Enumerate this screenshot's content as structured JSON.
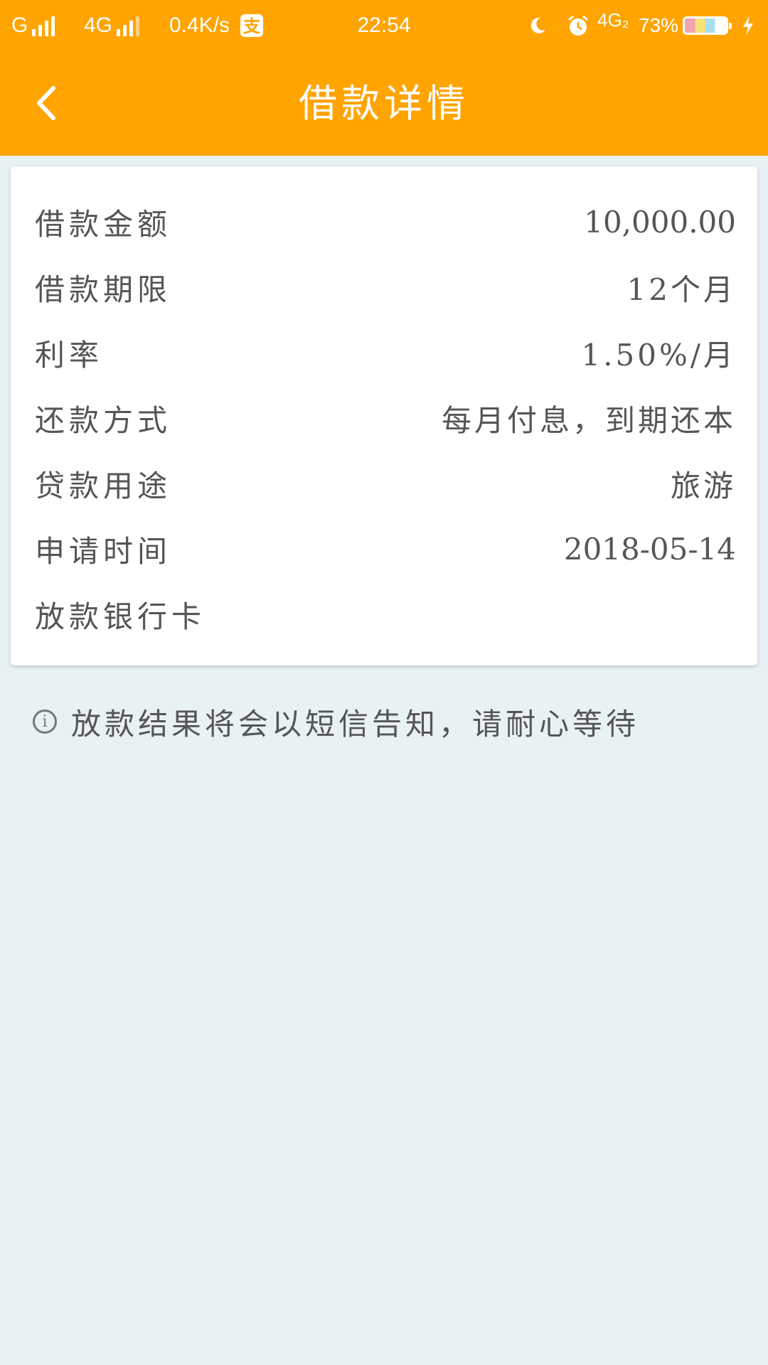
{
  "status_bar": {
    "carrier_1": "G",
    "carrier_2": "4G",
    "net_speed": "0.4K/s",
    "time": "22:54",
    "network_right": "4G₂",
    "battery": "73%",
    "app_icon": "alipay-icon",
    "moon_icon": "moon-icon",
    "alarm_icon": "alarm-icon",
    "charging_icon": "lightning-icon"
  },
  "header": {
    "back_icon": "chevron-left-icon",
    "title": "借款详情"
  },
  "details": [
    {
      "label": "借款金额",
      "value": "10,000.00"
    },
    {
      "label": "借款期限",
      "value": "12个月"
    },
    {
      "label": "利率",
      "value": "1.50%/月"
    },
    {
      "label": "还款方式",
      "value": "每月付息，到期还本"
    },
    {
      "label": "贷款用途",
      "value": "旅游"
    },
    {
      "label": "申请时间",
      "value": "2018-05-14"
    },
    {
      "label": "放款银行卡",
      "value": ""
    }
  ],
  "notice": {
    "icon": "info-icon",
    "text": "放款结果将会以短信告知，请耐心等待"
  },
  "colors": {
    "header": "#ffa400",
    "background": "#e8f1f3",
    "card": "#ffffff",
    "text": "#555555"
  }
}
